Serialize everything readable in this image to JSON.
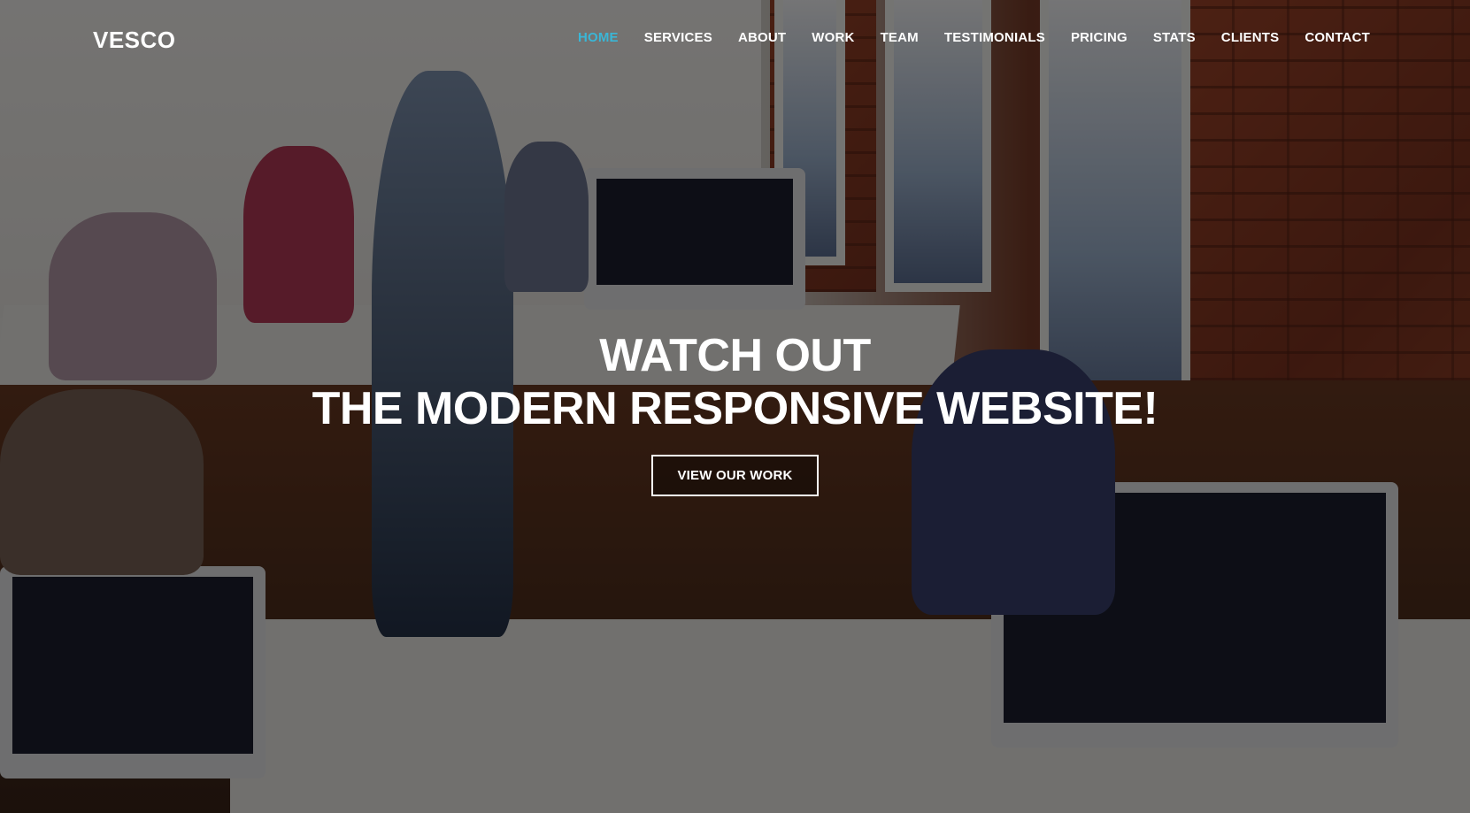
{
  "brand": {
    "logo_text": "VESCO"
  },
  "nav": {
    "items": [
      {
        "label": "HOME",
        "active": true
      },
      {
        "label": "SERVICES",
        "active": false
      },
      {
        "label": "ABOUT",
        "active": false
      },
      {
        "label": "WORK",
        "active": false
      },
      {
        "label": "TEAM",
        "active": false
      },
      {
        "label": "TESTIMONIALS",
        "active": false
      },
      {
        "label": "PRICING",
        "active": false
      },
      {
        "label": "STATS",
        "active": false
      },
      {
        "label": "CLIENTS",
        "active": false
      },
      {
        "label": "CONTACT",
        "active": false
      }
    ],
    "active_color": "#3ab6d6"
  },
  "hero": {
    "headline_line1": "WATCH OUT",
    "headline_line2": "THE MODERN RESPONSIVE WEBSITE!",
    "cta_label": "VIEW OUR WORK"
  }
}
